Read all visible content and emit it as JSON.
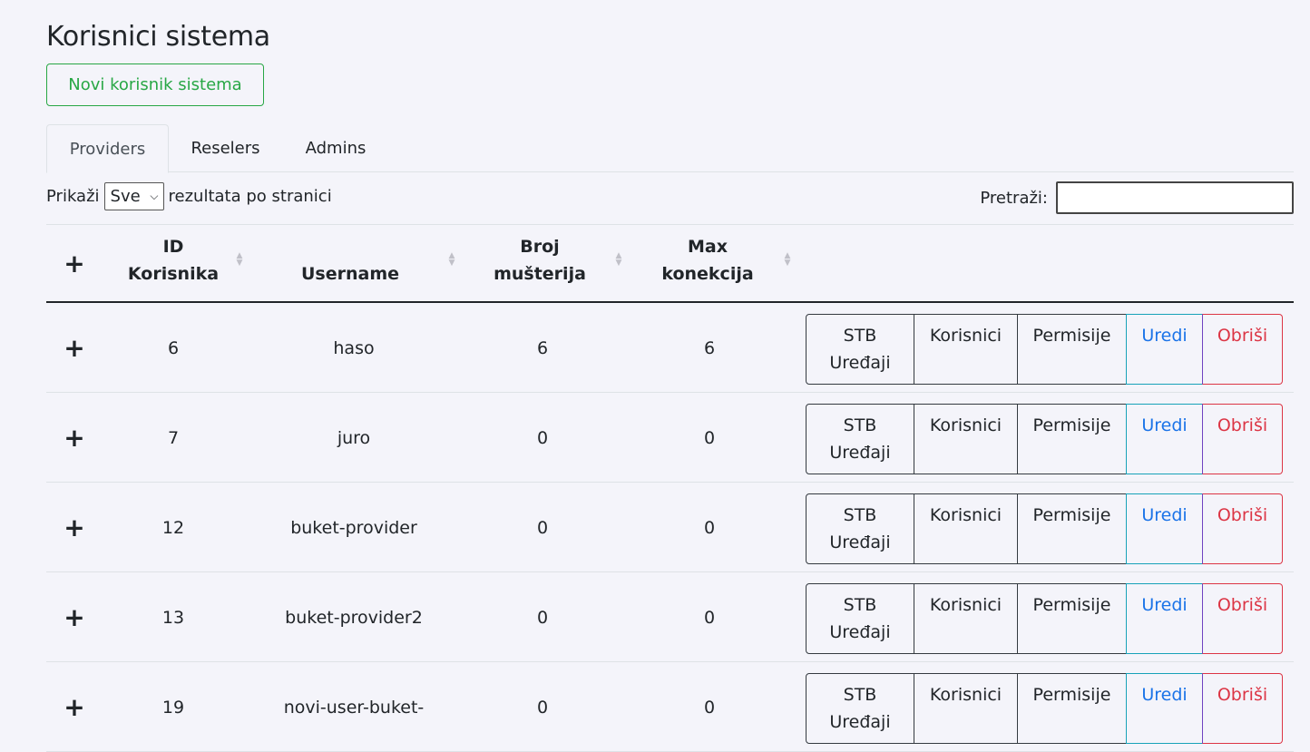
{
  "page": {
    "title": "Korisnici sistema",
    "new_button_label": "Novi korisnik sistema"
  },
  "tabs": [
    {
      "label": "Providers",
      "active": true
    },
    {
      "label": "Reselers",
      "active": false
    },
    {
      "label": "Admins",
      "active": false
    }
  ],
  "length_control": {
    "prefix": "Prikaži",
    "selected": "Sve",
    "suffix": "rezultata po stranici"
  },
  "search": {
    "label": "Pretraži:",
    "value": ""
  },
  "table": {
    "headers": {
      "expand": "+",
      "id_line1": "ID",
      "id_line2": "Korisnika",
      "username": "Username",
      "customers_line1": "Broj",
      "customers_line2": "mušterija",
      "maxconn_line1": "Max",
      "maxconn_line2": "konekcija"
    },
    "actions": {
      "stb_line1": "STB",
      "stb_line2": "Uređaji",
      "users": "Korisnici",
      "permissions": "Permisije",
      "edit": "Uredi",
      "delete": "Obriši"
    },
    "rows": [
      {
        "expand": "+",
        "id": "6",
        "username": "haso",
        "customers": "6",
        "max_connections": "6"
      },
      {
        "expand": "+",
        "id": "7",
        "username": "juro",
        "customers": "0",
        "max_connections": "0"
      },
      {
        "expand": "+",
        "id": "12",
        "username": "buket-provider",
        "customers": "0",
        "max_connections": "0"
      },
      {
        "expand": "+",
        "id": "13",
        "username": "buket-provider2",
        "customers": "0",
        "max_connections": "0"
      },
      {
        "expand": "+",
        "id": "19",
        "username": "novi-user-buket-",
        "customers": "0",
        "max_connections": "0"
      }
    ]
  },
  "colors": {
    "background": "#f4f4fa",
    "success": "#28a745",
    "edit": "#1a73e8",
    "danger": "#dc3545"
  },
  "icons": {
    "expand": "plus-icon",
    "sort": "sort-arrows-icon",
    "select": "chevron-down-icon"
  }
}
